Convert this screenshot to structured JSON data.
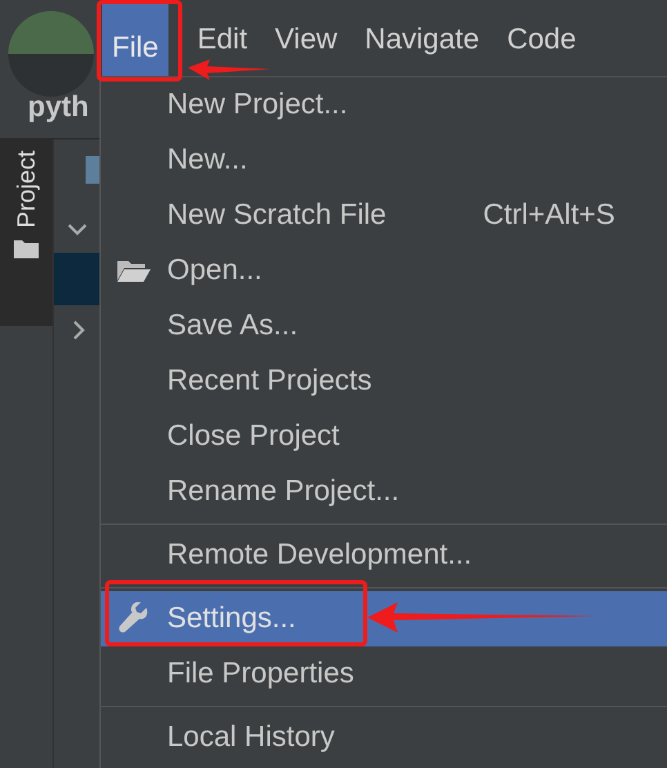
{
  "sidebar": {
    "project_name": "pyth",
    "tool_tab": "Project"
  },
  "menu_bar": [
    {
      "label": "File",
      "selected": true
    },
    {
      "label": "Edit",
      "selected": false
    },
    {
      "label": "View",
      "selected": false
    },
    {
      "label": "Navigate",
      "selected": false
    },
    {
      "label": "Code",
      "selected": false
    }
  ],
  "file_menu": [
    {
      "label": "New Project...",
      "selected": false,
      "separator_before": false
    },
    {
      "label": "New...",
      "selected": false,
      "separator_before": false
    },
    {
      "label": "New Scratch File",
      "shortcut": "Ctrl+Alt+S",
      "selected": false,
      "separator_before": false
    },
    {
      "label": "Open...",
      "kind": "folder",
      "selected": false,
      "separator_before": false
    },
    {
      "label": "Save As...",
      "selected": false,
      "separator_before": false
    },
    {
      "label": "Recent Projects",
      "selected": false,
      "separator_before": false
    },
    {
      "label": "Close Project",
      "selected": false,
      "separator_before": false
    },
    {
      "label": "Rename Project...",
      "selected": false,
      "separator_before": false
    },
    {
      "label": "Remote Development...",
      "selected": false,
      "separator_before": true
    },
    {
      "label": "Settings...",
      "kind": "wrench",
      "selected": true,
      "separator_before": true
    },
    {
      "label": "File Properties",
      "selected": false,
      "separator_before": false
    },
    {
      "label": "Local History",
      "selected": false,
      "separator_before": true
    }
  ]
}
